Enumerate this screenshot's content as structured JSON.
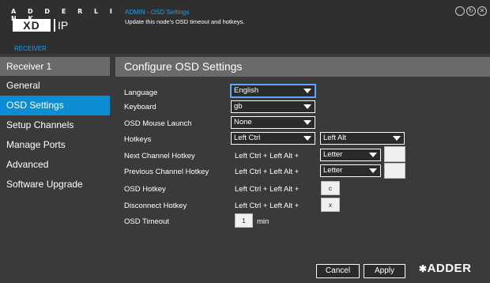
{
  "header": {
    "brand": "A D D E R L I N K",
    "logo_main": "XD",
    "logo_ip": "IP",
    "subtitle": "RECEIVER",
    "title": "ADMIN - OSD Settings",
    "description": "Update this node's OSD timeout and hotkeys."
  },
  "window_icons": [
    "circle-icon",
    "refresh-icon",
    "close-icon"
  ],
  "sidebar": {
    "header": "Receiver 1",
    "items": [
      {
        "label": "General"
      },
      {
        "label": "OSD Settings"
      },
      {
        "label": "Setup Channels"
      },
      {
        "label": "Manage Ports"
      },
      {
        "label": "Advanced"
      },
      {
        "label": "Software Upgrade"
      }
    ],
    "active_index": 1
  },
  "main": {
    "title": "Configure OSD Settings",
    "fields": {
      "language": {
        "label": "Language",
        "value": "English"
      },
      "keyboard": {
        "label": "Keyboard",
        "value": "gb"
      },
      "osd_mouse_launch": {
        "label": "OSD Mouse Launch",
        "value": "None"
      },
      "hotkeys": {
        "label": "Hotkeys",
        "value1": "Left Ctrl",
        "value2": "Left Alt"
      },
      "next_channel": {
        "label": "Next Channel Hotkey",
        "prefix": "Left Ctrl + Left Alt +",
        "value": "Letter",
        "key": ""
      },
      "prev_channel": {
        "label": "Previous Channel Hotkey",
        "prefix": "Left Ctrl + Left Alt +",
        "value": "Letter",
        "key": ""
      },
      "osd_hotkey": {
        "label": "OSD Hotkey",
        "prefix": "Left Ctrl + Left Alt +",
        "key": "c"
      },
      "disconnect_hotkey": {
        "label": "Disconnect Hotkey",
        "prefix": "Left Ctrl + Left Alt +",
        "key": "x"
      },
      "osd_timeout": {
        "label": "OSD Timeout",
        "value": "1",
        "unit": "min"
      }
    }
  },
  "footer": {
    "cancel": "Cancel",
    "apply": "Apply",
    "logo": "ADDER"
  },
  "colors": {
    "accent": "#0c8ed6",
    "header_bar": "#6a6a6a",
    "background": "#3a3a3a",
    "topbar": "#2f2f2f"
  }
}
